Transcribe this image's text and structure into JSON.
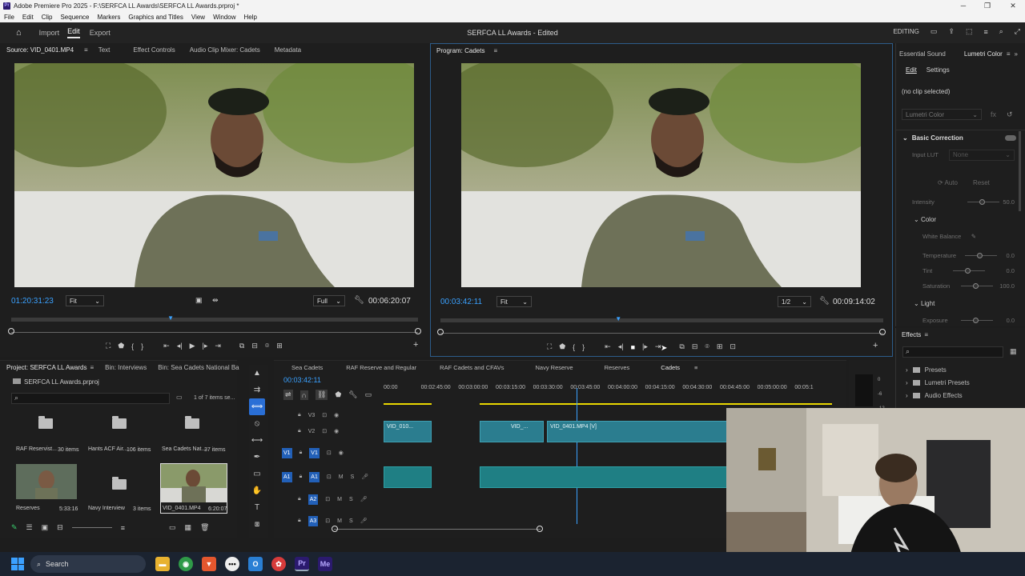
{
  "window": {
    "title": "Adobe Premiere Pro 2025 - F:\\SERFCA LL Awards\\SERFCA LL Awards.prproj *"
  },
  "menu": [
    "File",
    "Edit",
    "Clip",
    "Sequence",
    "Markers",
    "Graphics and Titles",
    "View",
    "Window",
    "Help"
  ],
  "header": {
    "tabs": [
      "Import",
      "Edit",
      "Export"
    ],
    "active_tab": "Edit",
    "project_title": "SERFCA LL Awards - Edited",
    "workspace": "EDITING"
  },
  "source_panel": {
    "tabs": [
      "Source: VID_0401.MP4",
      "Text",
      "Effect Controls",
      "Audio Clip Mixer: Cadets",
      "Metadata"
    ],
    "timecode": "01:20:31:23",
    "fit": "Fit",
    "resolution": "Full",
    "duration": "00:06:20:07",
    "playhead_fraction": 0.39
  },
  "program_panel": {
    "tab": "Program: Cadets",
    "timecode": "00:03:42:11",
    "fit": "Fit",
    "resolution": "1/2",
    "duration": "00:09:14:02",
    "playhead_fraction": 0.4
  },
  "right_panel": {
    "tabs": [
      "Essential Sound",
      "Lumetri Color"
    ],
    "subtabs": [
      "Edit",
      "Settings"
    ],
    "no_clip": "(no clip selected)",
    "effect_dropdown": "Lumetri Color",
    "basic_correction": "Basic Correction",
    "input_lut_label": "Input LUT",
    "input_lut_value": "None",
    "auto": "Auto",
    "reset": "Reset",
    "intensity_label": "Intensity",
    "intensity_value": "50.0",
    "color_section": "Color",
    "white_balance": "White Balance",
    "temperature_label": "Temperature",
    "temperature_value": "0.0",
    "tint_label": "Tint",
    "tint_value": "0.0",
    "saturation_label": "Saturation",
    "saturation_value": "100.0",
    "light_section": "Light",
    "exposure_label": "Exposure",
    "exposure_value": "0.0"
  },
  "effects_panel": {
    "title": "Effects",
    "items": [
      "Presets",
      "Lumetri Presets",
      "Audio Effects"
    ]
  },
  "project_panel": {
    "tabs": [
      "Project: SERFCA LL Awards",
      "Bin: Interviews",
      "Bin: Sea Cadets National Ba"
    ],
    "file": "SERFCA LL Awards.prproj",
    "items_count": "1 of 7 items se...",
    "bins": [
      {
        "name": "RAF Reservist...",
        "meta": "30 items",
        "type": "folder"
      },
      {
        "name": "Hants ACF Air...",
        "meta": "106 items",
        "type": "folder"
      },
      {
        "name": "Sea Cadets Nat...",
        "meta": "37 items",
        "type": "folder"
      },
      {
        "name": "Reserves",
        "meta": "5:33:16",
        "type": "sequence"
      },
      {
        "name": "Navy Interview",
        "meta": "3 items",
        "type": "folder"
      },
      {
        "name": "VID_0401.MP4",
        "meta": "6:20:07",
        "type": "clip"
      }
    ]
  },
  "timeline": {
    "tabs": [
      "Sea Cadets",
      "RAF Reserve and Regular",
      "RAF Cadets and CFAVs",
      "Navy Reserve",
      "Reserves",
      "Cadets"
    ],
    "active_tab": "Cadets",
    "timecode": "00:03:42:11",
    "ruler": [
      "00:00",
      "00:02:45:00",
      "00:03:00:00",
      "00:03:15:00",
      "00:03:30:00",
      "00:03:45:00",
      "00:04:00:00",
      "00:04:15:00",
      "00:04:30:00",
      "00:04:45:00",
      "00:05:00:00",
      "00:05:1"
    ],
    "tracks": [
      "V3",
      "V2",
      "V1",
      "A1",
      "A2",
      "A3"
    ],
    "clips_v2": [
      "VID_010...",
      "VID_...",
      "VID_0401.MP4 [V]"
    ],
    "meter": [
      "0",
      "-6",
      "-12"
    ]
  },
  "taskbar": {
    "search": "Search"
  }
}
